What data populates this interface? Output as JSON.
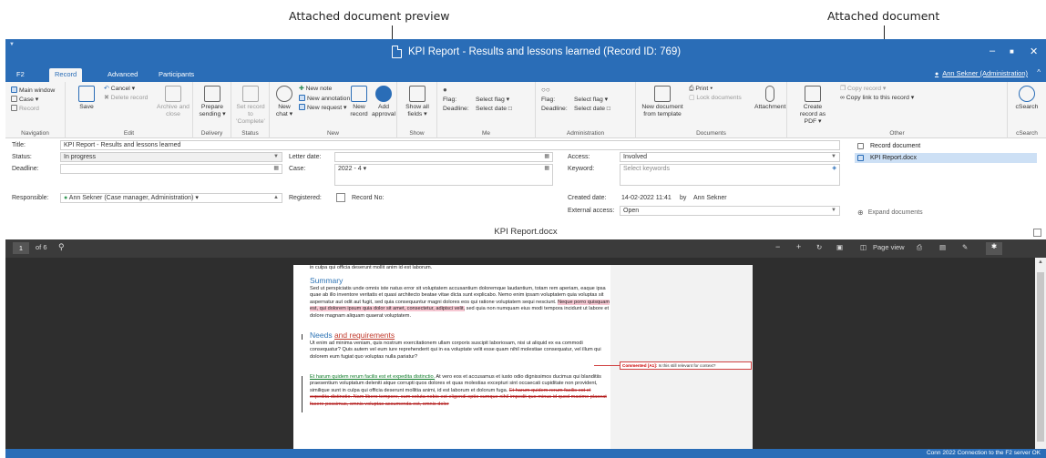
{
  "annotations": {
    "left": "Attached document preview",
    "right": "Attached document"
  },
  "window": {
    "title": "KPI Report - Results and lessons learned (Record ID: 769)",
    "controls": [
      "–",
      "■",
      "✕"
    ]
  },
  "tabs": [
    "F2",
    "Record",
    "Advanced",
    "Participants"
  ],
  "user": "Ann Sekner (Administration)",
  "ribbon": {
    "navigation": {
      "label": "Navigation",
      "items": [
        "Main window",
        "Case",
        "Record"
      ]
    },
    "edit": {
      "label": "Edit",
      "save": "Save",
      "cancel": "Cancel",
      "delete": "Delete record",
      "archive": "Archive and close"
    },
    "delivery": {
      "label": "Delivery",
      "prepare": "Prepare sending"
    },
    "status": {
      "label": "Status",
      "set": "Set record to 'Complete'"
    },
    "new": {
      "label": "New",
      "chat": "New chat",
      "note": "New note",
      "annotation": "New annotation",
      "request": "New request",
      "record": "New record",
      "approval": "Add approval"
    },
    "show": {
      "label": "Show",
      "all": "Show all fields"
    },
    "me": {
      "label": "Me",
      "flag": "Flag:",
      "deadline": "Deadline:",
      "select_flag": "Select flag",
      "select_date": "Select date"
    },
    "administration": {
      "label": "Administration",
      "flag": "Flag:",
      "deadline": "Deadline:",
      "select_flag": "Select flag",
      "select_date": "Select date"
    },
    "documents": {
      "label": "Documents",
      "from_template": "New document from template",
      "print": "Print",
      "lock": "Lock documents",
      "attachment": "Attachment"
    },
    "other": {
      "label": "Other",
      "pdf": "Create record as PDF",
      "copy": "Copy record",
      "copy_link": "Copy link to this record"
    },
    "csearch": {
      "label": "cSearch",
      "button": "cSearch"
    }
  },
  "form": {
    "title_label": "Title:",
    "title_value": "KPI Report - Results and lessons learned",
    "status_label": "Status:",
    "status_value": "In progress",
    "deadline_label": "Deadline:",
    "letter_date_label": "Letter date:",
    "case_label": "Case:",
    "case_value": "2022 - 4",
    "access_label": "Access:",
    "access_value": "Involved",
    "keyword_label": "Keyword:",
    "keyword_placeholder": "Select keywords",
    "responsible_label": "Responsible:",
    "responsible_value": "Ann Sekner (Case manager, Administration)",
    "registered_label": "Registered:",
    "record_no_label": "Record No:",
    "created_label": "Created date:",
    "created_value": "14-02-2022 11:41",
    "by": "by",
    "created_by": "Ann Sekner",
    "external_label": "External access:",
    "external_value": "Open"
  },
  "sidepanel": {
    "record_document": "Record document",
    "file": "KPI Report.docx",
    "expand": "Expand documents"
  },
  "viewer": {
    "filename": "KPI Report.docx",
    "page": "1",
    "of": "of 6",
    "page_view": "Page view"
  },
  "document": {
    "line0": "in culpa qui officia deserunt mollit anim id est laborum.",
    "h1": "Summary",
    "p1a": "Sed ut perspiciatis unde omnis iste natus error sit voluptatem accusantium doloremque laudantium, totam rem aperiam, eaque ipsa quae ab illo inventore veritatis et quasi architecto beatae vitae dicta sunt explicabo. Nemo enim ipsam voluptatem quia voluptas sit aspernatur aut odit aut fugit, sed quia consequuntur magni dolores eos qui ratione voluptatem sequi nesciunt.",
    "p1h": "Neque porro quisquam est, qui dolorem ipsum quia dolor sit amet, consectetur, adipisci velit,",
    "p1b": "sed quia non numquam eius modi tempora incidunt ut labore et dolore magnam aliquam quaerat voluptatem.",
    "h2a": "Needs",
    "h2b": "and requirements",
    "p2": "Ut enim ad minima veniam, quis nostrum exercitationem ullam corporis suscipit laboriosam, nisi ut aliquid ex ea commodi consequatur? Quis autem vel eum iure reprehenderit qui in ea voluptate velit esse quam nihil molestiae consequatur, vel illum qui dolorem eum fugiat quo voluptas nulla pariatur?",
    "p3ins": "Et harum quidem rerum facilis est et expedita distinctio.",
    "p3": "At vero eos et accusamus et iusto odio dignissimos ducimus qui blanditiis praesentium voluptatum deleniti atque corrupti quos dolores et quas molestias excepturi sint occaecati cupiditate non provident, similique sunt in culpa qui officia deserunt mollitia animi, id est laborum et dolorum fuga.",
    "p3del": "Et harum quidem rerum facilis est et expedita distinctio. Nam libero tempore, cum soluta nobis est eligendi optio cumque nihil impedit quo minus id quod maxime placeat facere possimus, omnis voluptas assumenda est, omnis dolor",
    "comment_tag": "Commented [A1]:",
    "comment_text": "Is this still relevant for context?"
  },
  "statusbar": {
    "text": "Conn 2022   Connection to the F2 server OK"
  },
  "colors": {
    "accent": "#2a6db7",
    "viewer_bg": "#2e2e2e",
    "heading": "#2e74b5",
    "highlight": "#f7c8d3"
  }
}
